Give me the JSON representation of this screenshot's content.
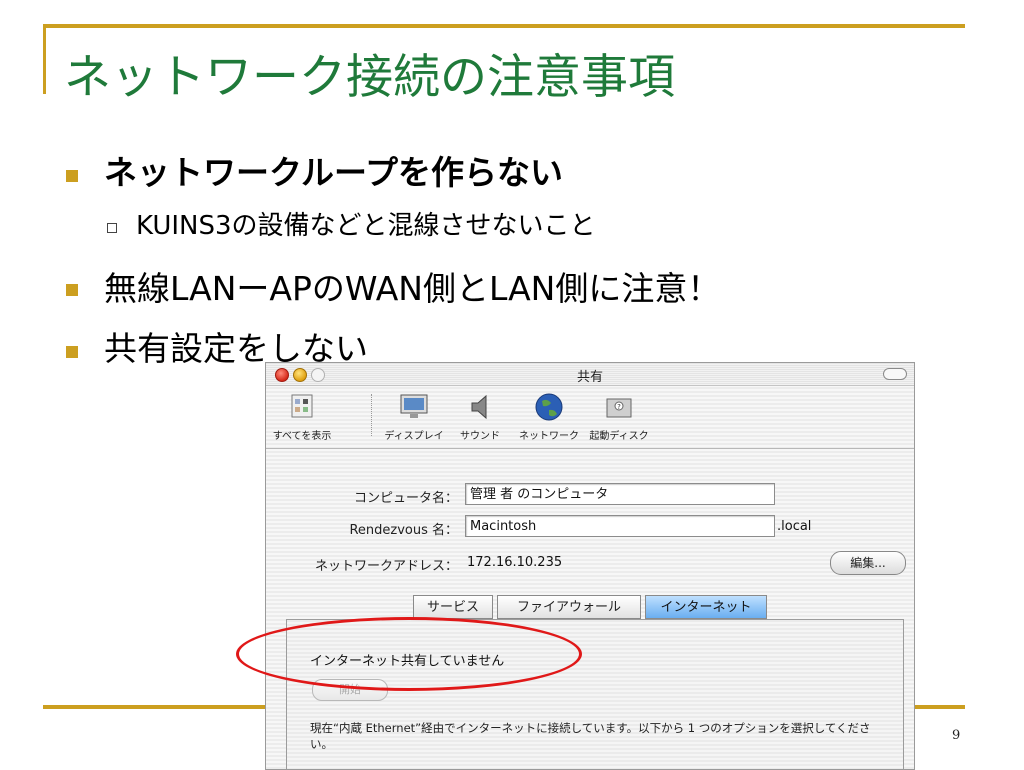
{
  "slide": {
    "title": "ネットワーク接続の注意事項",
    "bullets": [
      "ネットワークループを作らない",
      "無線LANーAPのWAN側とLAN側に注意！",
      "共有設定をしない"
    ],
    "sub_bullet": "KUINS3の設備などと混線させないこと",
    "page_number": "9"
  },
  "window": {
    "title": "共有",
    "toolbar": [
      "すべてを表示",
      "ディスプレイ",
      "サウンド",
      "ネットワーク",
      "起動ディスク"
    ],
    "computer_name_label": "コンピュータ名：",
    "computer_name_value": "管理 者 のコンピュータ",
    "rendezvous_label": "Rendezvous 名：",
    "rendezvous_value": "Macintosh",
    "rendezvous_suffix": ".local",
    "network_address_label": "ネットワークアドレス：",
    "network_address_value": "172.16.10.235",
    "edit_button": "編集...",
    "tabs": [
      "サービス",
      "ファイアウォール",
      "インターネット"
    ],
    "internet_status": "インターネット共有していません",
    "start_button": "開始",
    "description": "現在“内蔵 Ethernet”経由でインターネットに接続しています。以下から 1 つのオプションを選択してください。"
  },
  "colors": {
    "accent": "#cc9f20",
    "title": "#1f7a3a",
    "highlight": "#e01818"
  }
}
